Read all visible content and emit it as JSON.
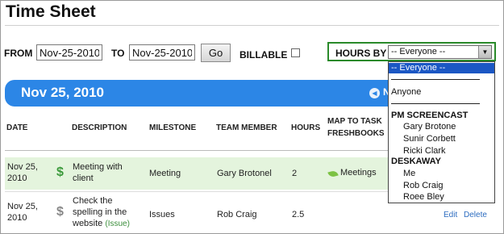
{
  "page": {
    "title": "Time Sheet"
  },
  "filters": {
    "from_label": "FROM",
    "from_value": "Nov-25-2010",
    "to_label": "TO",
    "to_value": "Nov-25-2010",
    "go_label": "Go",
    "billable_label": "BILLABLE",
    "billable_checked": false,
    "hours_by_label": "HOURS BY",
    "hours_by_value": "-- Everyone --"
  },
  "date_bar": {
    "date": "Nov 25, 2010",
    "next_label": "N"
  },
  "table": {
    "headers": {
      "date": "DATE",
      "description": "DESCRIPTION",
      "milestone": "MILESTONE",
      "team_member": "TEAM MEMBER",
      "hours": "HOURS",
      "map_to_task_line1": "MAP TO TASK",
      "map_to_task_line2": "FRESHBOOKS"
    },
    "rows": [
      {
        "date_line1": "Nov 25,",
        "date_line2": "2010",
        "billable": true,
        "description_line1": "Meeting with",
        "description_line2": "client",
        "milestone": "Meeting",
        "team_member": "Gary Brotonel",
        "hours": "2",
        "task": "Meetings"
      },
      {
        "date_line1": "Nov 25,",
        "date_line2": "2010",
        "billable": false,
        "description_line1": "Check the",
        "description_line2": "spelling in the",
        "description_line3": "website",
        "issue_tag": "(Issue)",
        "milestone": "Issues",
        "team_member": "Rob Craig",
        "hours": "2.5",
        "edit_label": "Edit",
        "delete_label": "Delete"
      }
    ]
  },
  "dropdown": {
    "selected": "-- Everyone --",
    "anyone": "Anyone",
    "groups": [
      {
        "name": "PM SCREENCAST",
        "members": [
          "Gary Brotone",
          "Sunir Corbett",
          "Ricki Clark"
        ]
      },
      {
        "name": "DESKAWAY",
        "members": [
          "Me",
          "Rob Craig",
          "Roee Bley"
        ]
      }
    ]
  },
  "colors": {
    "accent_blue": "#2c86e6",
    "billable_green": "#3c9a3c",
    "row_highlight": "#e4f4dd",
    "hours_box_border": "#2a8a2a",
    "dropdown_selection": "#1b57c4"
  },
  "icons": {
    "billable": "dollar-icon",
    "task": "leaf-icon",
    "prev": "prev-arrow-icon",
    "select": "dropdown-arrow-icon"
  }
}
